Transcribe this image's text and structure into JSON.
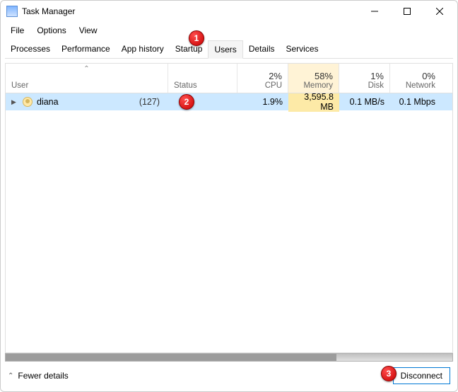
{
  "window": {
    "title": "Task Manager"
  },
  "menu": {
    "file": "File",
    "options": "Options",
    "view": "View"
  },
  "tabs": {
    "processes": "Processes",
    "performance": "Performance",
    "app_history": "App history",
    "startup": "Startup",
    "users": "Users",
    "details": "Details",
    "services": "Services"
  },
  "columns": {
    "user": "User",
    "status": "Status",
    "cpu_pct": "2%",
    "cpu_label": "CPU",
    "memory_pct": "58%",
    "memory_label": "Memory",
    "disk_pct": "1%",
    "disk_label": "Disk",
    "network_pct": "0%",
    "network_label": "Network"
  },
  "rows": [
    {
      "name": "diana",
      "process_count": "(127)",
      "status": "",
      "cpu": "1.9%",
      "memory": "3,595.8 MB",
      "disk": "0.1 MB/s",
      "network": "0.1 Mbps"
    }
  ],
  "footer": {
    "fewer_details": "Fewer details",
    "disconnect": "Disconnect"
  },
  "callouts": {
    "one": "1",
    "two": "2",
    "three": "3"
  }
}
